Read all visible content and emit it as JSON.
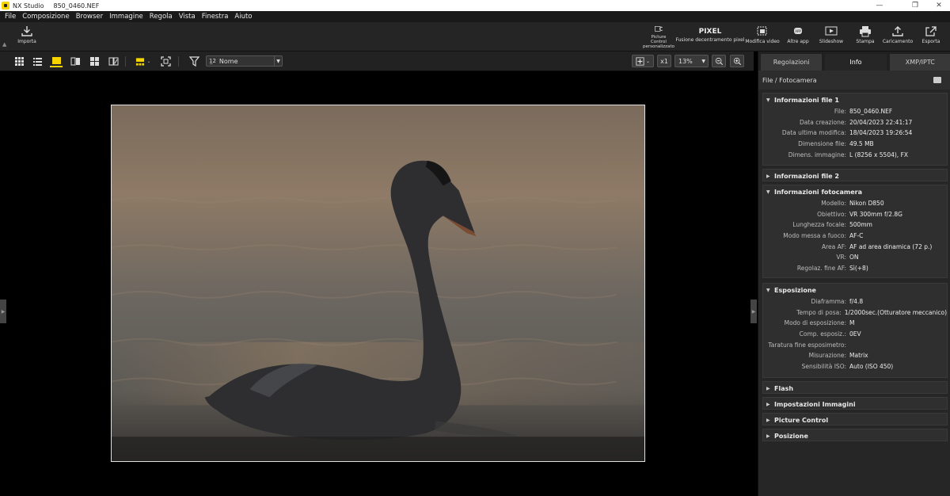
{
  "app": {
    "name": "NX Studio",
    "file": "850_0460.NEF"
  },
  "window_controls": {
    "minimize": "—",
    "maximize": "❐",
    "close": "✕"
  },
  "menu": [
    "File",
    "Composizione",
    "Browser",
    "Immagine",
    "Regola",
    "Vista",
    "Finestra",
    "Aiuto"
  ],
  "toolbar": {
    "import": "Importa",
    "picture_control": "Picture Control personalizzato",
    "pixel_badge": "PIXEL",
    "pixel_shift": "Fusione decentramento pixel",
    "edit_movie": "Modifica video",
    "other_apps": "Altre app",
    "slideshow": "Slideshow",
    "print": "Stampa",
    "upload": "Caricamento",
    "export": "Esporta"
  },
  "viewbar": {
    "sort_label": "Nome",
    "sort_prefix": "1̲2",
    "zoom_1x": "x1",
    "zoom_value": "13%"
  },
  "colors": {
    "accent_yellow": "#f5d400",
    "panel_bg": "#262626"
  },
  "panel": {
    "tabs": [
      "Regolazioni",
      "Info",
      "XMP/IPTC"
    ],
    "active_tab": "Info",
    "header": "File / Fotocamera",
    "sections": [
      {
        "title": "Informazioni file 1",
        "expanded": true,
        "rows": [
          {
            "k": "File:",
            "v": "850_0460.NEF"
          },
          {
            "k": "Data creazione:",
            "v": "20/04/2023 22:41:17"
          },
          {
            "k": "Data ultima modifica:",
            "v": "18/04/2023 19:26:54"
          },
          {
            "k": "Dimensione file:",
            "v": "49.5 MB"
          },
          {
            "k": "Dimens. immagine:",
            "v": "L (8256 x 5504), FX"
          }
        ]
      },
      {
        "title": "Informazioni file 2",
        "expanded": false,
        "rows": []
      },
      {
        "title": "Informazioni fotocamera",
        "expanded": true,
        "rows": [
          {
            "k": "Modello:",
            "v": "Nikon D850"
          },
          {
            "k": "Obiettivo:",
            "v": "VR 300mm f/2.8G"
          },
          {
            "k": "Lunghezza focale:",
            "v": "500mm"
          },
          {
            "k": "Modo messa a fuoco:",
            "v": "AF-C"
          },
          {
            "k": "Area AF:",
            "v": "AF ad area dinamica (72 p.)"
          },
          {
            "k": "VR:",
            "v": "ON"
          },
          {
            "k": "Regolaz. fine AF:",
            "v": "Sì(+8)"
          }
        ]
      },
      {
        "title": "Esposizione",
        "expanded": true,
        "rows": [
          {
            "k": "Diaframma:",
            "v": "f/4.8"
          },
          {
            "k": "Tempo di posa:",
            "v": "1/2000sec.(Otturatore meccanico)"
          },
          {
            "k": "Modo di esposizione:",
            "v": "M"
          },
          {
            "k": "Comp. esposiz.:",
            "v": "0EV"
          },
          {
            "k": "Taratura fine esposimetro:",
            "v": ""
          },
          {
            "k": "Misurazione:",
            "v": "Matrix"
          },
          {
            "k": "Sensibilità ISO:",
            "v": "Auto (ISO 450)"
          }
        ]
      },
      {
        "title": "Flash",
        "expanded": false,
        "rows": []
      },
      {
        "title": "Impostazioni Immagini",
        "expanded": false,
        "rows": []
      },
      {
        "title": "Picture Control",
        "expanded": false,
        "rows": []
      },
      {
        "title": "Posizione",
        "expanded": false,
        "rows": []
      }
    ]
  }
}
